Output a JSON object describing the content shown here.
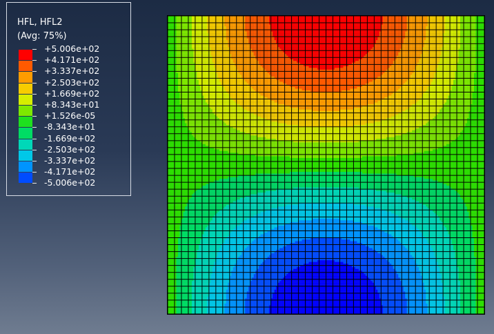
{
  "legend": {
    "title_line1": "HFL, HFL2",
    "title_line2": "(Avg: 75%)",
    "entries": [
      {
        "value": "+5.006e+02",
        "color": "#ff0000"
      },
      {
        "value": "+4.171e+02",
        "color": "#ff5a00"
      },
      {
        "value": "+3.337e+02",
        "color": "#ff9c00"
      },
      {
        "value": "+2.503e+02",
        "color": "#f7cc00"
      },
      {
        "value": "+1.669e+02",
        "color": "#d6ee00"
      },
      {
        "value": "+8.343e+01",
        "color": "#7ee800"
      },
      {
        "value": "+1.526e-05",
        "color": "#1ee01e"
      },
      {
        "value": "-8.343e+01",
        "color": "#00dc64"
      },
      {
        "value": "-1.669e+02",
        "color": "#00d8b8"
      },
      {
        "value": "-2.503e+02",
        "color": "#00c8e8"
      },
      {
        "value": "-3.337e+02",
        "color": "#0094ff"
      },
      {
        "value": "-4.171e+02",
        "color": "#004cff"
      },
      {
        "value": "-5.006e+02",
        "color": "#0000ff"
      }
    ]
  },
  "contour": {
    "band_colors": [
      "#ff0000",
      "#ff5a00",
      "#ff9c00",
      "#f7cc00",
      "#d6ee00",
      "#7ee800",
      "#2de000",
      "#00dc64",
      "#00d8b8",
      "#00c8e8",
      "#0094ff",
      "#004cff",
      "#0000ff"
    ],
    "mesh_color": "#000000"
  }
}
